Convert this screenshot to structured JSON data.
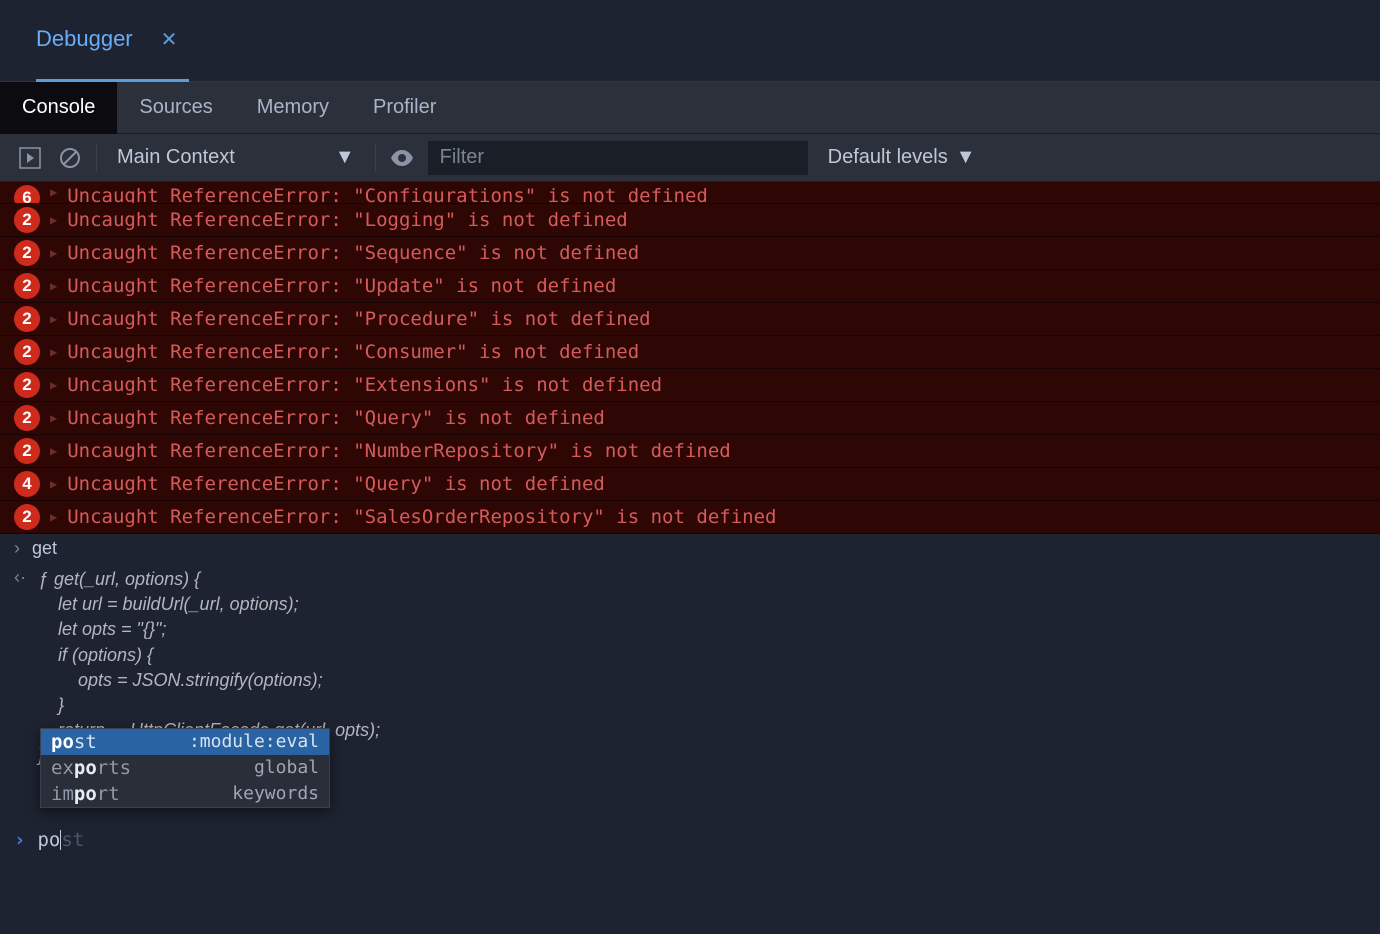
{
  "mainTab": {
    "label": "Debugger"
  },
  "panelTabs": {
    "console": "Console",
    "sources": "Sources",
    "memory": "Memory",
    "profiler": "Profiler"
  },
  "toolbar": {
    "context": "Main Context",
    "filterPlaceholder": "Filter",
    "levels": "Default levels"
  },
  "errors": [
    {
      "count": "6",
      "text": "Uncaught ReferenceError: \"Configurations\" is not defined",
      "truncated": true
    },
    {
      "count": "2",
      "text": "Uncaught ReferenceError: \"Logging\" is not defined"
    },
    {
      "count": "2",
      "text": "Uncaught ReferenceError: \"Sequence\" is not defined"
    },
    {
      "count": "2",
      "text": "Uncaught ReferenceError: \"Update\" is not defined"
    },
    {
      "count": "2",
      "text": "Uncaught ReferenceError: \"Procedure\" is not defined"
    },
    {
      "count": "2",
      "text": "Uncaught ReferenceError: \"Consumer\" is not defined"
    },
    {
      "count": "2",
      "text": "Uncaught ReferenceError: \"Extensions\" is not defined"
    },
    {
      "count": "2",
      "text": "Uncaught ReferenceError: \"Query\" is not defined"
    },
    {
      "count": "2",
      "text": "Uncaught ReferenceError: \"NumberRepository\" is not defined"
    },
    {
      "count": "4",
      "text": "Uncaught ReferenceError: \"Query\" is not defined"
    },
    {
      "count": "2",
      "text": "Uncaught ReferenceError: \"SalesOrderRepository\" is not defined"
    }
  ],
  "history": {
    "inputLabel": "get",
    "fnKeyword": "ƒ",
    "codeLines": [
      "get(_url, options) {",
      "    let url = buildUrl(_url, options);",
      "    let opts = \"{}\";",
      "    if (options) {",
      "        opts = JSON.stringify(options);",
      "    }",
      "    return __HttpClientFacade.get(url, opts);",
      "}"
    ]
  },
  "autocomplete": {
    "items": [
      {
        "prefix": "po",
        "rest": "st",
        "source": ":module:eval",
        "selected": true
      },
      {
        "prefix": "po",
        "pre": "ex",
        "rest": "rts",
        "source": "global"
      },
      {
        "prefix": "po",
        "pre": "im",
        "rest": "rt",
        "source": "keywords"
      }
    ]
  },
  "currentInput": {
    "typed": "po",
    "ghost": "st"
  }
}
